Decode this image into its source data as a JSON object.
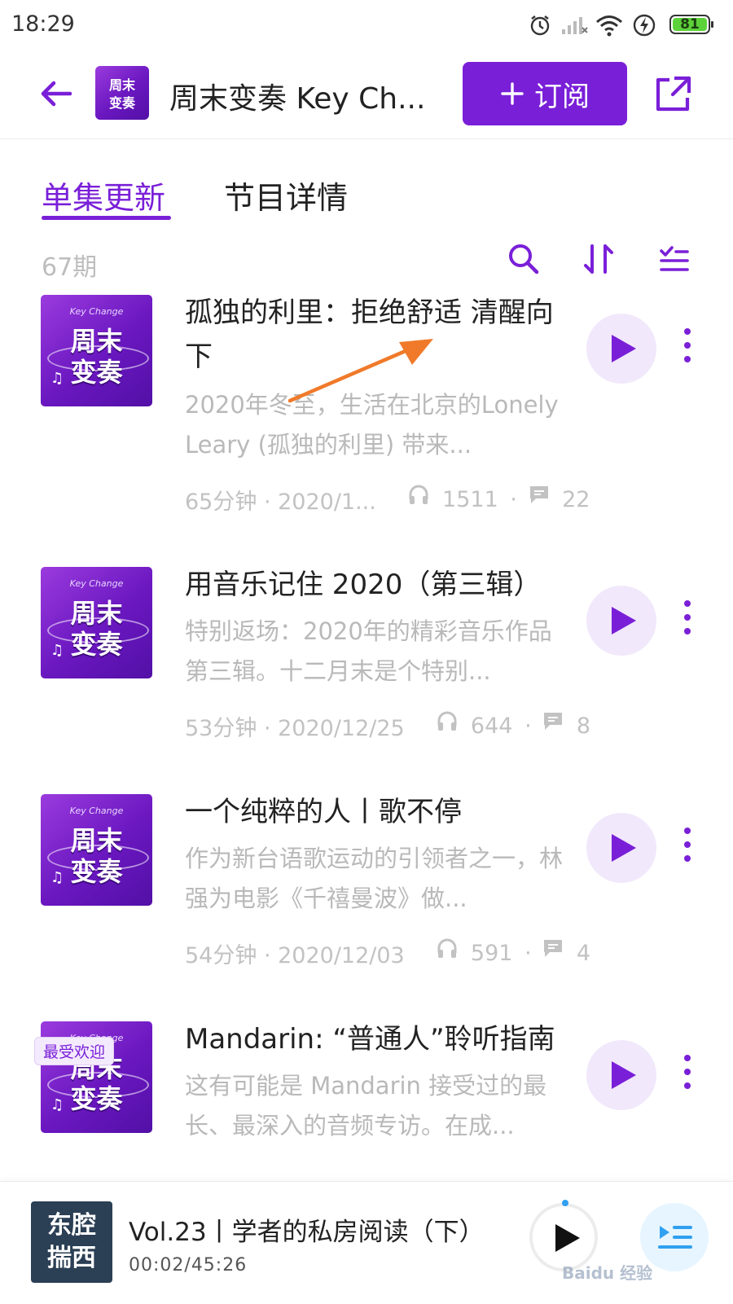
{
  "status_bar": {
    "time": "18:29",
    "battery": "81"
  },
  "header": {
    "podcast_title": "周末变奏 Key Ch...",
    "subscribe_label": "订阅"
  },
  "tabs": [
    {
      "label": "单集更新",
      "active": true
    },
    {
      "label": "节目详情",
      "active": false
    }
  ],
  "list": {
    "episode_count": "67期"
  },
  "cover_art": {
    "small_text": "Key Change",
    "line1": "周末",
    "line2": "变奏",
    "header_line1": "周末",
    "header_line2": "变奏"
  },
  "episodes": [
    {
      "title": "孤独的利里：拒绝舒适 清醒向下",
      "desc": "2020年冬至，生活在北京的Lonely Leary (孤独的利里) 带来...",
      "duration_date": "65分钟 · 2020/1...",
      "plays": "1511",
      "comments": "22"
    },
    {
      "title": "用音乐记住 2020（第三辑）",
      "desc": "特别返场：2020年的精彩音乐作品第三辑。十二月末是个特别...",
      "duration_date": "53分钟 · 2020/12/25",
      "plays": "644",
      "comments": "8"
    },
    {
      "title": "一个纯粹的人丨歌不停",
      "desc": "作为新台语歌运动的引领者之一，林强为电影《千禧曼波》做...",
      "duration_date": "54分钟 · 2020/12/03",
      "plays": "591",
      "comments": "4"
    },
    {
      "title": "Mandarin: “普通人”聆听指南",
      "desc": "这有可能是 Mandarin 接受过的最长、最深入的音频专访。在成...",
      "badge": "最受欢迎"
    }
  ],
  "player": {
    "cover_line1": "东腔",
    "cover_line2": "揣西",
    "title": "Vol.23丨学者的私房阅读（下）",
    "time": "00:02/45:26"
  },
  "watermark": "Baidu 经验",
  "colors": {
    "accent": "#7a1fd8",
    "arrow": "#f07a2a"
  }
}
